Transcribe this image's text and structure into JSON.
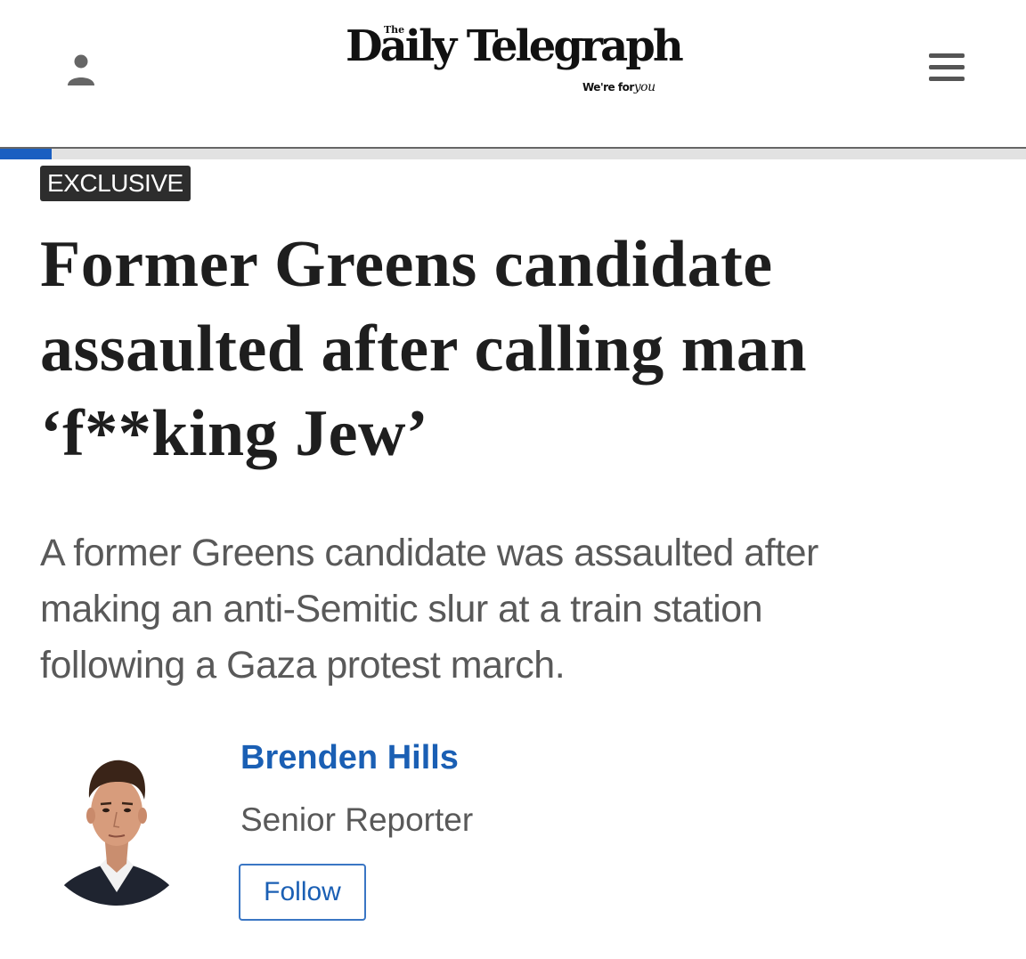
{
  "header": {
    "logo": {
      "the": "The",
      "name": "Daily Telegraph",
      "tagline_prefix": "We're for",
      "tagline_script": "you"
    },
    "icons": {
      "user": "user-icon",
      "menu": "hamburger-menu-icon"
    }
  },
  "reading_progress": 0.05,
  "article": {
    "badge": "EXCLUSIVE",
    "headline_lines": [
      "Former Greens candidate",
      "assaulted after calling man",
      "‘f**king Jew’"
    ],
    "standfirst_lines": [
      "A former Greens candidate was assaulted after",
      "making an anti-Semitic slur at a train station",
      "following a Gaza protest march."
    ]
  },
  "author": {
    "name": "Brenden Hills",
    "role": "Senior Reporter",
    "follow_label": "Follow"
  },
  "colors": {
    "accent_blue": "#1a5fb4",
    "progress_blue": "#1a5fc1",
    "badge_bg": "#2d2d2d",
    "headline": "#1e1e1e",
    "body_grey": "#595959"
  }
}
